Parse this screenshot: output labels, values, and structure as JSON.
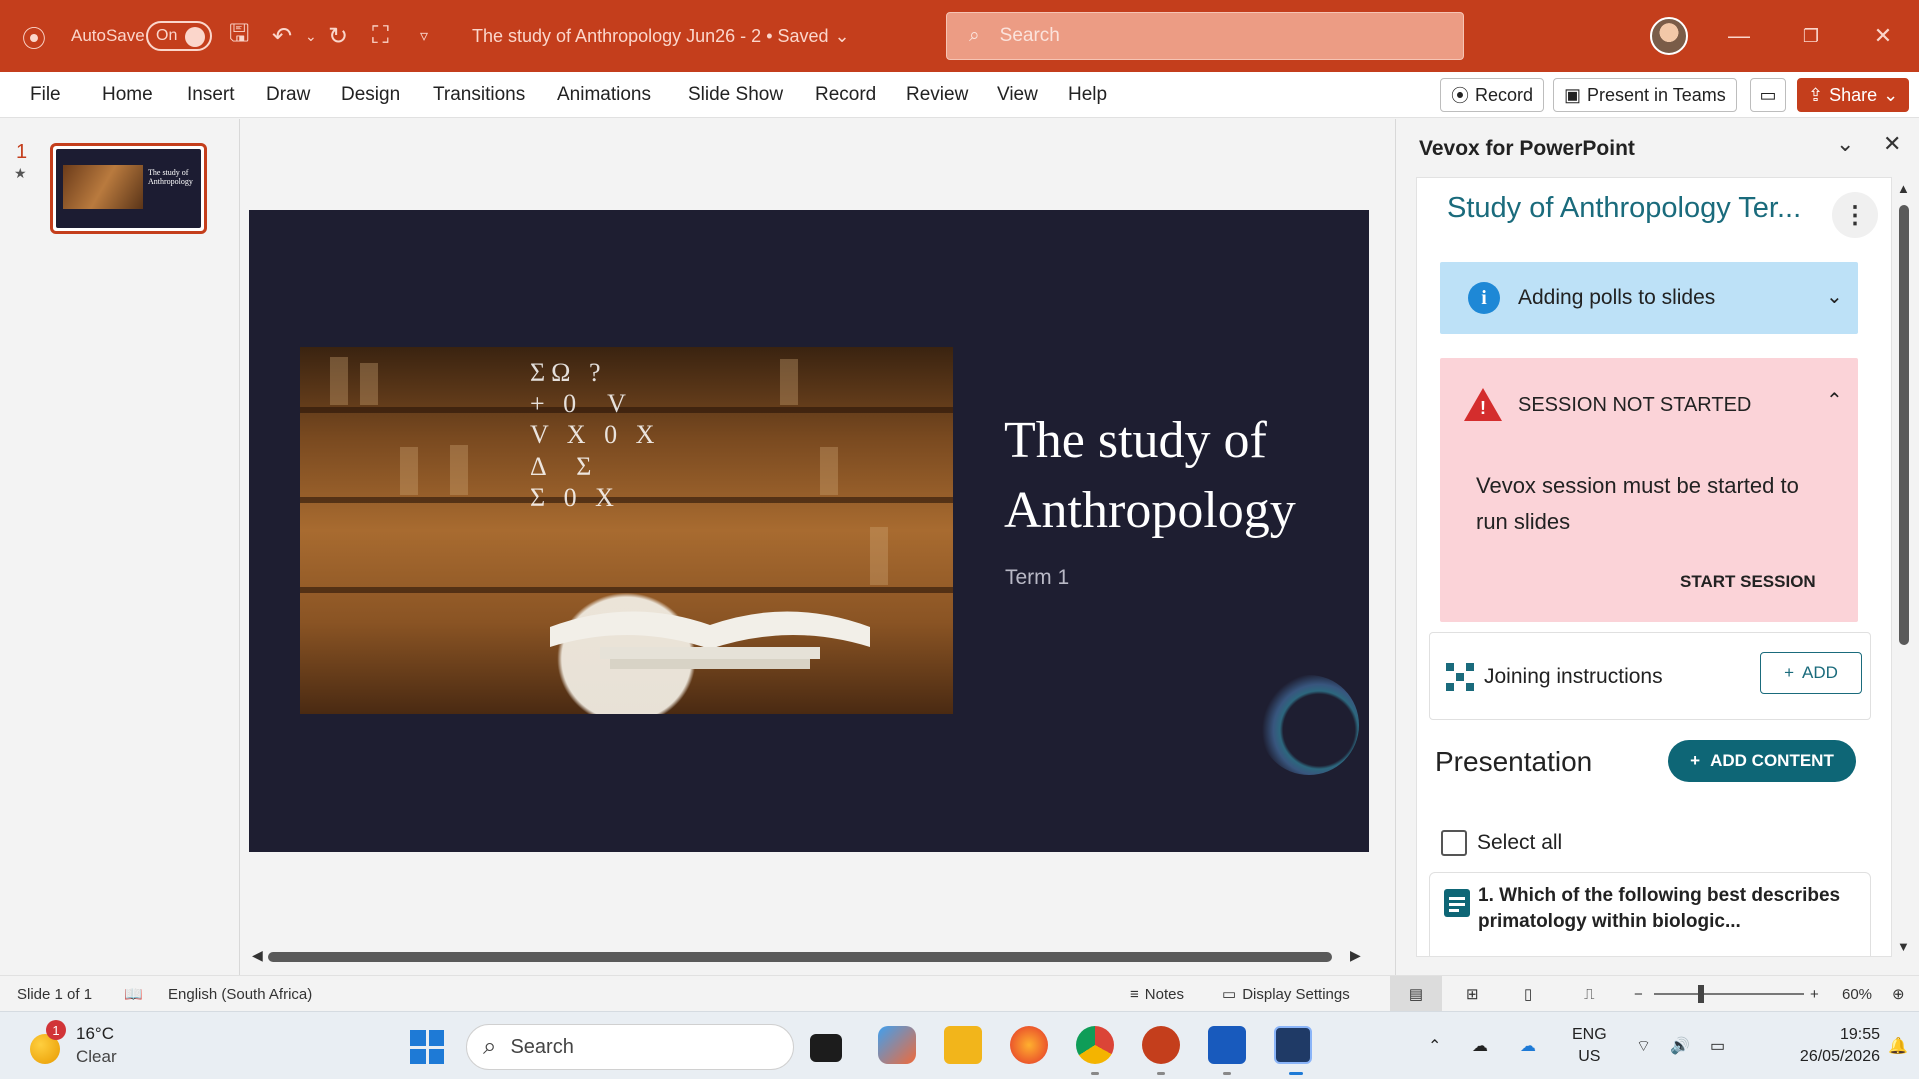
{
  "titlebar": {
    "autosave_label": "AutoSave",
    "autosave_state": "On",
    "document_title": "The study of Anthropology  Jun26  -  2  •  Saved",
    "search_placeholder": "Search",
    "controls": {
      "minimize": "—",
      "restore": "❐",
      "close": "✕"
    }
  },
  "ribbon": {
    "tabs": [
      "File",
      "Home",
      "Insert",
      "Draw",
      "Design",
      "Transitions",
      "Animations",
      "Slide Show",
      "Record",
      "Review",
      "View",
      "Help"
    ],
    "record_label": "Record",
    "present_teams_label": "Present in Teams",
    "share_label": "Share"
  },
  "thumbnails": {
    "slide_number": "1",
    "thumb_title": "The study of Anthropology"
  },
  "slide": {
    "title": "The study of Anthropology",
    "subtitle": "Term 1",
    "glyph_text": "ΣΩ ?\n+ 0  V\nV X 0 X\nΔ  Σ\nΣ 0 X"
  },
  "addin": {
    "title": "Vevox for PowerPoint",
    "session_title": "Study of Anthropology Ter...",
    "info_card": "Adding polls to slides",
    "warning_heading": "SESSION NOT STARTED",
    "warning_text": "Vevox session must be started to run slides",
    "start_session": "START SESSION",
    "joining_label": "Joining instructions",
    "add_label": "ADD",
    "presentation_label": "Presentation",
    "add_content_label": "ADD CONTENT",
    "select_all": "Select all",
    "question_1": "1. Which of the following best describes primatology within biologic..."
  },
  "statusbar": {
    "slide_info": "Slide 1 of 1",
    "language": "English (South Africa)",
    "notes": "Notes",
    "display_settings": "Display Settings",
    "zoom": "60%"
  },
  "taskbar": {
    "weather_badge": "1",
    "temperature": "16°C",
    "weather_desc": "Clear",
    "search_label": "Search",
    "lang_1": "ENG",
    "lang_2": "US",
    "time": "19:55",
    "date": "26/05/2026"
  },
  "colors": {
    "brand": "#c43e1c",
    "slide_bg": "#1e1e31",
    "vevox_teal": "#0e6676",
    "info_bg": "#bde1f7",
    "warning_bg": "#fbd3d8"
  }
}
